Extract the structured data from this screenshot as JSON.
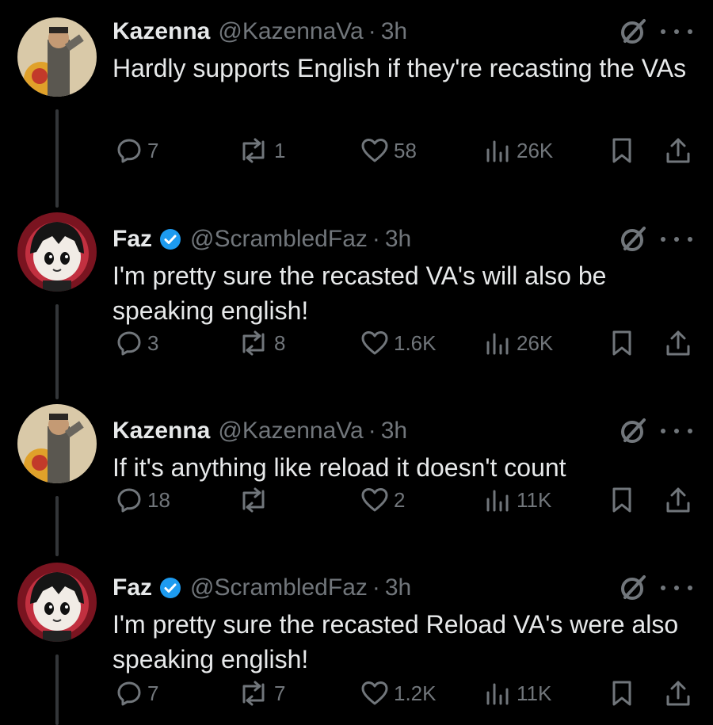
{
  "tweets": [
    {
      "name": "Kazenna",
      "handle": "@KazennaVa",
      "separator": "·",
      "time": "3h",
      "verified": false,
      "avatar": "kazenna-avatar",
      "text": "Hardly supports English if they're recasting the VAs",
      "replies": "7",
      "reposts": "1",
      "likes": "58",
      "views": "26K"
    },
    {
      "name": "Faz",
      "handle": "@ScrambledFaz",
      "separator": "·",
      "time": "3h",
      "verified": true,
      "avatar": "faz-avatar",
      "text": "I'm pretty sure the recasted VA's will also be speaking english!",
      "replies": "3",
      "reposts": "8",
      "likes": "1.6K",
      "views": "26K"
    },
    {
      "name": "Kazenna",
      "handle": "@KazennaVa",
      "separator": "·",
      "time": "3h",
      "verified": false,
      "avatar": "kazenna-avatar",
      "text": "If it's anything like reload it doesn't count",
      "replies": "18",
      "reposts": "",
      "likes": "2",
      "views": "11K"
    },
    {
      "name": "Faz",
      "handle": "@ScrambledFaz",
      "separator": "·",
      "time": "3h",
      "verified": true,
      "avatar": "faz-avatar",
      "text": "I'm pretty sure the recasted Reload VA's were also speaking english!",
      "replies": "7",
      "reposts": "7",
      "likes": "1.2K",
      "views": "11K"
    }
  ],
  "colors": {
    "background": "#000000",
    "primary_text": "#e7e9ea",
    "secondary_text": "#71767b",
    "verified_badge": "#1d9bf0",
    "thread_line": "#333639"
  },
  "icons": {
    "reply": "reply-icon",
    "repost": "repost-icon",
    "like": "heart-icon",
    "views": "views-icon",
    "bookmark": "bookmark-icon",
    "share": "share-icon",
    "grok": "grok-icon",
    "more": "more-icon",
    "verified": "verified-badge-icon"
  }
}
